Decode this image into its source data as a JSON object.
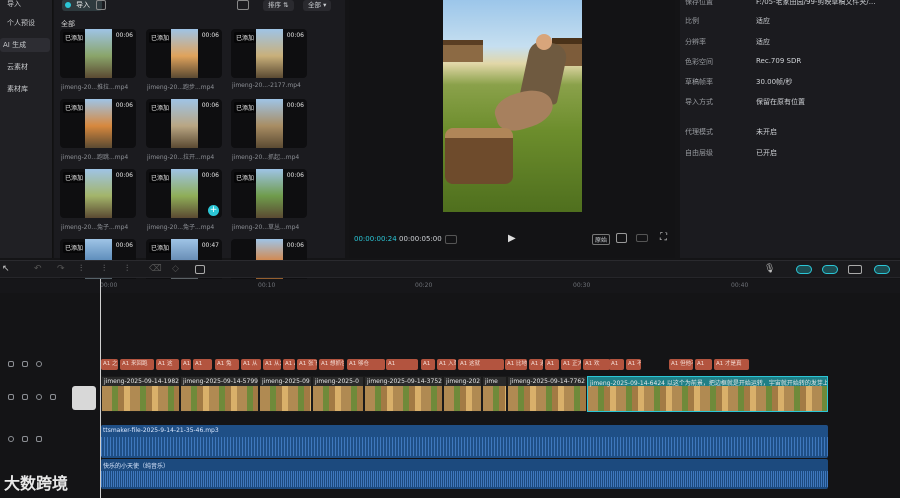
{
  "left_nav": {
    "items": [
      "导入",
      "个人预设",
      "AI 生成",
      "云素材",
      "素材库"
    ]
  },
  "media": {
    "import_label": "导入",
    "sort_label": "排序",
    "filter_label": "全部",
    "category": "全部",
    "cards": [
      {
        "badge": "已添加",
        "duration": "00:06",
        "name": "jimeng-20...推拉...mp4"
      },
      {
        "badge": "已添加",
        "duration": "00:06",
        "name": "jimeng-20...跑步...mp4"
      },
      {
        "badge": "已添加",
        "duration": "00:06",
        "name": "jimeng-20...-2177.mp4"
      },
      {
        "badge": "已添加",
        "duration": "00:06",
        "name": "jimeng-20...跑跳...mp4"
      },
      {
        "badge": "已添加",
        "duration": "00:06",
        "name": "jimeng-20...拉开...mp4"
      },
      {
        "badge": "已添加",
        "duration": "00:06",
        "name": "jimeng-20...抓起...mp4"
      },
      {
        "badge": "已添加",
        "duration": "00:06",
        "name": "jimeng-20...兔子...mp4"
      },
      {
        "badge": "已添加",
        "duration": "00:06",
        "name": "jimeng-20...兔子...mp4"
      },
      {
        "badge": "已添加",
        "duration": "00:06",
        "name": "jimeng-20...草丛...mp4"
      },
      {
        "badge": "已添加",
        "duration": "00:06",
        "name": ""
      },
      {
        "badge": "已添加",
        "duration": "00:47",
        "name": ""
      },
      {
        "badge": "",
        "duration": "00:06",
        "name": ""
      }
    ]
  },
  "player": {
    "current_time": "00:00:00:24",
    "total_time": "00:00:05:00",
    "ratio_label": "原始"
  },
  "properties": {
    "rows": [
      {
        "label": "保存位置",
        "value": "F:/05-老家田园/99-剪映草稿文件夹/..."
      },
      {
        "label": "比例",
        "value": "适应"
      },
      {
        "label": "分辨率",
        "value": "适应"
      },
      {
        "label": "色彩空间",
        "value": "Rec.709 SDR"
      },
      {
        "label": "草稿帧率",
        "value": "30.00帧/秒"
      },
      {
        "label": "导入方式",
        "value": "保留在原有位置"
      },
      {
        "label": "代理模式",
        "value": "未开启"
      },
      {
        "label": "自由层级",
        "value": "已开启"
      }
    ]
  },
  "timeline": {
    "ruler": [
      "00:00",
      "00:10",
      "00:20",
      "00:30",
      "00:40"
    ],
    "subtitles": [
      "A1 之",
      "A1 来回跑",
      "A1 这",
      "A1",
      "A1",
      "A1 兔",
      "A1 从",
      "A1 从之",
      "A1 A",
      "A1 张下",
      "A1 想抓住",
      "A1 够仓",
      "A1",
      "A1",
      "A1 入草了外",
      "A1 这就",
      "A1 比地",
      "A1 通",
      "A1",
      "A1 正大心",
      "A1 欢",
      "A1",
      "A1 不",
      "A1 但他不",
      "A1",
      "A1 才是真"
    ],
    "video_clips": [
      {
        "label": "jimeng-2025-09-14-1982"
      },
      {
        "label": "jimeng-2025-09-14-5799"
      },
      {
        "label": "jimeng-2025-09"
      },
      {
        "label": "jimeng-2025-0"
      },
      {
        "label": "jimeng-2025-09-14-3752"
      },
      {
        "label": "jimeng-202"
      },
      {
        "label": "jime"
      },
      {
        "label": "jimeng-2025-09-14-7762"
      },
      {
        "label": "jimeng-2025-09-14-6424 以这个为前景，把边框就是开始运转，宇宙就开始转的发芽上面"
      }
    ],
    "audio_tts": "ttsmaker-file-2025-9-14-21-35-46.mp3",
    "audio_music": "快乐的小天使（纯音乐）",
    "watermark": "大数跨境"
  },
  "colors": {
    "accent": "#2bc6d6",
    "subtitle": "#b3543f",
    "audio": "#1f4f86",
    "video_clip_border": "#25a3a8"
  }
}
